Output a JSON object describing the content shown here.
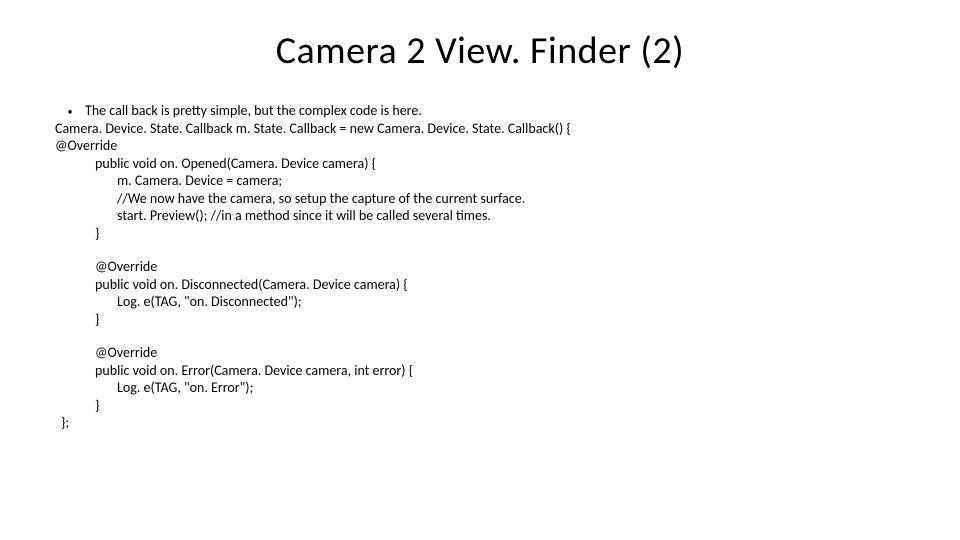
{
  "title": "Camera 2 View. Finder (2)",
  "bullet_mark": "•",
  "bullet_text": "The call back is pretty simple, but the complex code is here.",
  "lines_block1": [
    "Camera. Device. State. Callback m. State. Callback = new Camera. Device. State. Callback() {",
    " @Override"
  ],
  "lines_block2": [
    "public void on. Opened(Camera. Device camera) {"
  ],
  "lines_block3": [
    "m. Camera. Device = camera;",
    "//We now have the camera, so setup the capture of the current surface.",
    "start. Preview();  //in a method since it will be called several times."
  ],
  "lines_block4": [
    "}"
  ],
  "lines_block5": [
    "@Override",
    "public void on. Disconnected(Camera. Device camera) {"
  ],
  "lines_block6": [
    "Log. e(TAG, \"on. Disconnected\");"
  ],
  "lines_block7": [
    "}"
  ],
  "lines_block8": [
    "@Override",
    "public void on. Error(Camera. Device camera, int error) {"
  ],
  "lines_block9": [
    "Log. e(TAG, \"on. Error\");"
  ],
  "lines_block10": [
    "}"
  ],
  "lines_block11": [
    "};"
  ]
}
